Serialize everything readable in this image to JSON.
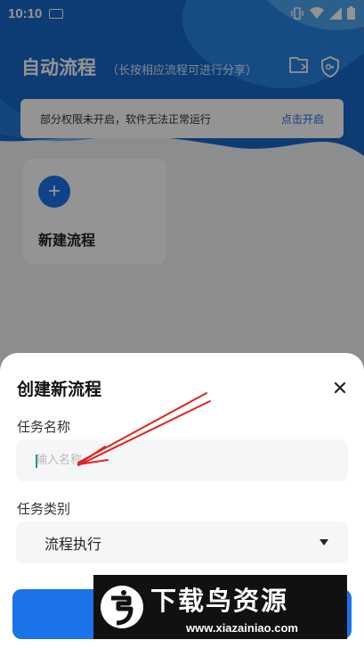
{
  "status_bar": {
    "time": "10:10"
  },
  "header": {
    "title": "自动流程",
    "subtitle": "（长按相应流程可进行分享）"
  },
  "permission_banner": {
    "message": "部分权限未开启，软件无法正常运行",
    "action": "点击开启"
  },
  "new_flow_card": {
    "label": "新建流程"
  },
  "dialog": {
    "title": "创建新流程",
    "name_label": "任务名称",
    "name_value": "",
    "name_placeholder": "输入名称",
    "type_label": "任务类别",
    "type_value": "流程执行"
  },
  "watermark": {
    "brand": "下载鸟资源",
    "url": "www.xiazainiao.com"
  },
  "colors": {
    "primary": "#1a73e8",
    "annotation_arrow": "#e0231f"
  }
}
